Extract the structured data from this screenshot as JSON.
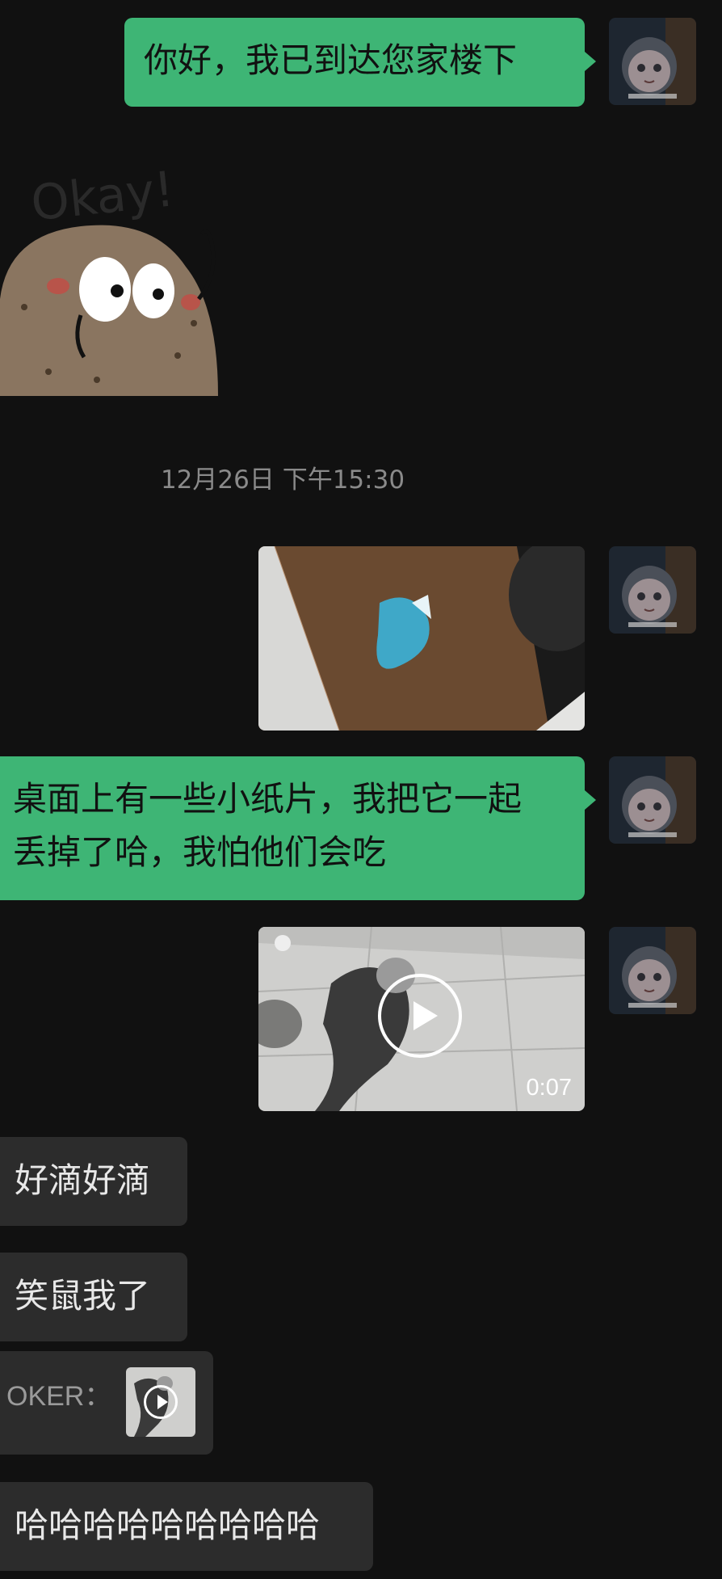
{
  "messages": {
    "out_arrival": "你好，我已到达您家楼下",
    "sticker_text": "Okay!",
    "timestamp": "12月26日 下午15:30",
    "out_paper_line1": "桌面上有一些小纸片，我把它一起",
    "out_paper_line2": "丢掉了哈，我怕他们会吃",
    "video_duration": "0:07",
    "in_reply1": "好滴好滴",
    "in_reply2": "笑鼠我了",
    "quote_sender": "OKER：",
    "in_reply3": "哈哈哈哈哈哈哈哈哈"
  },
  "colors": {
    "background": "#111111",
    "outgoing_bubble": "#3EB575",
    "incoming_bubble": "#2C2C2C",
    "timestamp_text": "#8A8A8A"
  },
  "icons": {
    "video_play": "play-circle-icon",
    "quote_play": "play-circle-icon"
  }
}
